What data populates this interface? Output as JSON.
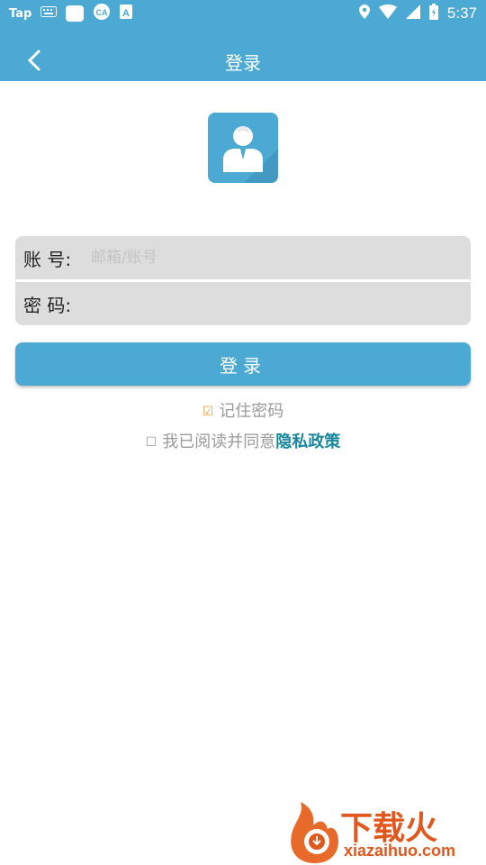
{
  "status_bar": {
    "app_label": "Tap",
    "time": "5:37",
    "icons": [
      "tap-icon",
      "keyboard-icon",
      "white-square-icon",
      "ca-icon",
      "a-icon",
      "location-icon",
      "wifi-icon",
      "signal-icon",
      "battery-icon"
    ]
  },
  "app_bar": {
    "title": "登录",
    "back_icon": "chevron-left-icon"
  },
  "avatar": {
    "icon": "user-avatar-icon"
  },
  "form": {
    "account_label": "账 号:",
    "account_placeholder": "邮箱/账号",
    "account_value": "",
    "password_label": "密 码:",
    "password_value": ""
  },
  "login_button": "登录",
  "remember_password": {
    "checked": true,
    "label": "记住密码"
  },
  "agreement": {
    "checked": false,
    "text": "我已阅读并同意",
    "link": "隐私政策"
  },
  "watermark": {
    "text": "下载火",
    "sub": "xiazaihuo.com"
  },
  "colors": {
    "primary": "#4ba9d3",
    "field_bg": "#dddddd",
    "link": "#17879d",
    "check_accent": "#e7a14a"
  }
}
